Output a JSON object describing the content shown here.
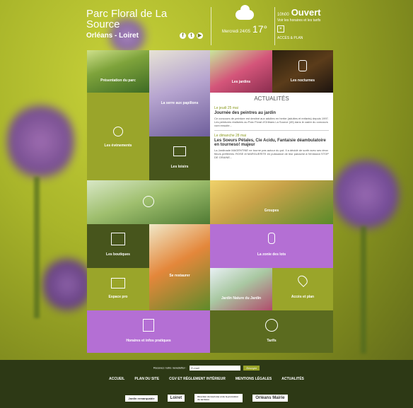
{
  "header": {
    "title_line1": "Parc Floral de La",
    "title_line2": "Source",
    "subtitle": "Orléans - Loiret",
    "social": [
      "f",
      "t",
      "▶"
    ],
    "weather_date": "Mercredi 24/05",
    "weather_temp": "17°",
    "status_time": "10h00",
    "status": "Ouvert",
    "status_sub": "Voir les horaires et les tarifs",
    "access_label": "ACCÈS & PLAN"
  },
  "tiles": {
    "presentation": "Présentation du parc",
    "papillons": "La serre aux papillons",
    "jardins": "Les jardins",
    "nocturnes": "Les nocturnes",
    "evenements": "Les événements",
    "loisirs": "Les loisirs",
    "groupes": "Groupes",
    "boutiques": "Les boutiques",
    "restaurant": "Se restaurer",
    "zone_lots": "La zonie des lots",
    "espace_pro": "Espace pro",
    "jardin_nature": "Jardin Nature du Jardin",
    "acces_plan": "Accès et plan",
    "horaires": "Horaires et infos pratiques",
    "tarifs": "Tarifs"
  },
  "news": {
    "heading": "ACTUALITÉS",
    "items": [
      {
        "date": "Le jeudi 25 mai",
        "title": "Journée des peintres au jardin",
        "text": "Ce concours de peinture est destiné aux adultes en herbe (adultes et enfants) depuis 1997. Les peintures réalisées au Parc Floral d'Orléans La Source (45) dans le cadre du concours vont ensuite..."
      },
      {
        "date": "Le dimanche 28 mai",
        "title": "Les Soeurs Pétales, Cie Acidu, Fantaisie déambulatoire en tourneso! majeur",
        "text": "La Jardinade MAGENTINE ne tourne pas autour du pot. Il a décidé de sortir avec ses deux fleurs préférées: ROSE et MARGUERITE en puissance de leur panache à l'émission STOP DE GRAINE..."
      }
    ]
  },
  "footer": {
    "newsletter_label": "Recevez notre newsletter :",
    "email_placeholder": "E-mail",
    "submit_label": "Envoyer",
    "menu": [
      "ACCUEIL",
      "PLAN DU SITE",
      "CGV ET RÈGLEMENT INTÉRIEUR",
      "MENTIONS LÉGALES",
      "ACTUALITÉS"
    ],
    "logos": [
      "Jardin remarquable",
      "Loiret",
      "Direction du tourisme et de la promotion du territoire",
      "Orléans Mairie"
    ]
  },
  "colors": {
    "olive": "#9aa52a",
    "dark_green": "#47551c",
    "purple": "#b46fd4",
    "footer": "#2d3915"
  }
}
